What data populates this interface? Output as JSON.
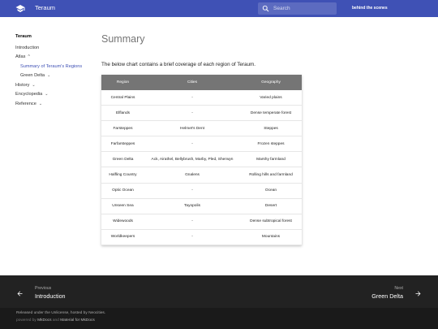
{
  "header": {
    "site_title": "Teraum",
    "search_placeholder": "Search",
    "top_link": "behind the scenes",
    "logo_icon": "graduation-cap-icon",
    "color": "#3f51b5"
  },
  "nav": {
    "title": "Teraum",
    "items": [
      {
        "label": "Introduction"
      },
      {
        "label": "Atlas",
        "chevron": "^"
      },
      {
        "label": "Summary of Teraum's Regions"
      },
      {
        "label": "Green Delta",
        "chevron": "v"
      },
      {
        "label": "History",
        "chevron": "v"
      },
      {
        "label": "Encyclopedia",
        "chevron": "v"
      },
      {
        "label": "Reference",
        "chevron": "v"
      }
    ]
  },
  "main": {
    "title": "Summary",
    "intro": "The below chart contains a brief coverage of each region of Teraum."
  },
  "table": {
    "headers": [
      "Region",
      "Cities",
      "Geography"
    ],
    "rows": [
      [
        "Central Plains",
        "-",
        "Varied plains"
      ],
      [
        "Elflands",
        "-",
        "Dense temperate forest"
      ],
      [
        "Farsteppes",
        "Helmet's Dent",
        "Steppes"
      ],
      [
        "Farfarsteppes",
        "-",
        "Frozen steppes"
      ],
      [
        "Green Delta",
        "Ack, Airathel, Bellybrush, Marby, Pled, Sherwyn",
        "Marshy farmland"
      ],
      [
        "Halfling Country",
        "Gnalens",
        "Rolling hills and farmland"
      ],
      [
        "Optic Ocean",
        "-",
        "Ocean"
      ],
      [
        "Unseen Sea",
        "Tayopolis",
        "Desert"
      ],
      [
        "Widewoods",
        "-",
        "Dense subtropical forest"
      ],
      [
        "Worldkeepers",
        "-",
        "Mountains"
      ]
    ]
  },
  "footer": {
    "prev_direction": "Previous",
    "prev_title": "Introduction",
    "next_direction": "Next",
    "next_title": "Green Delta",
    "license_text": "Released under the Unlicense, hosted by Neocities.",
    "powered_by": "powered by",
    "mkdocs": "MkDocs",
    "and": "and",
    "material": "Material for MkDocs"
  }
}
